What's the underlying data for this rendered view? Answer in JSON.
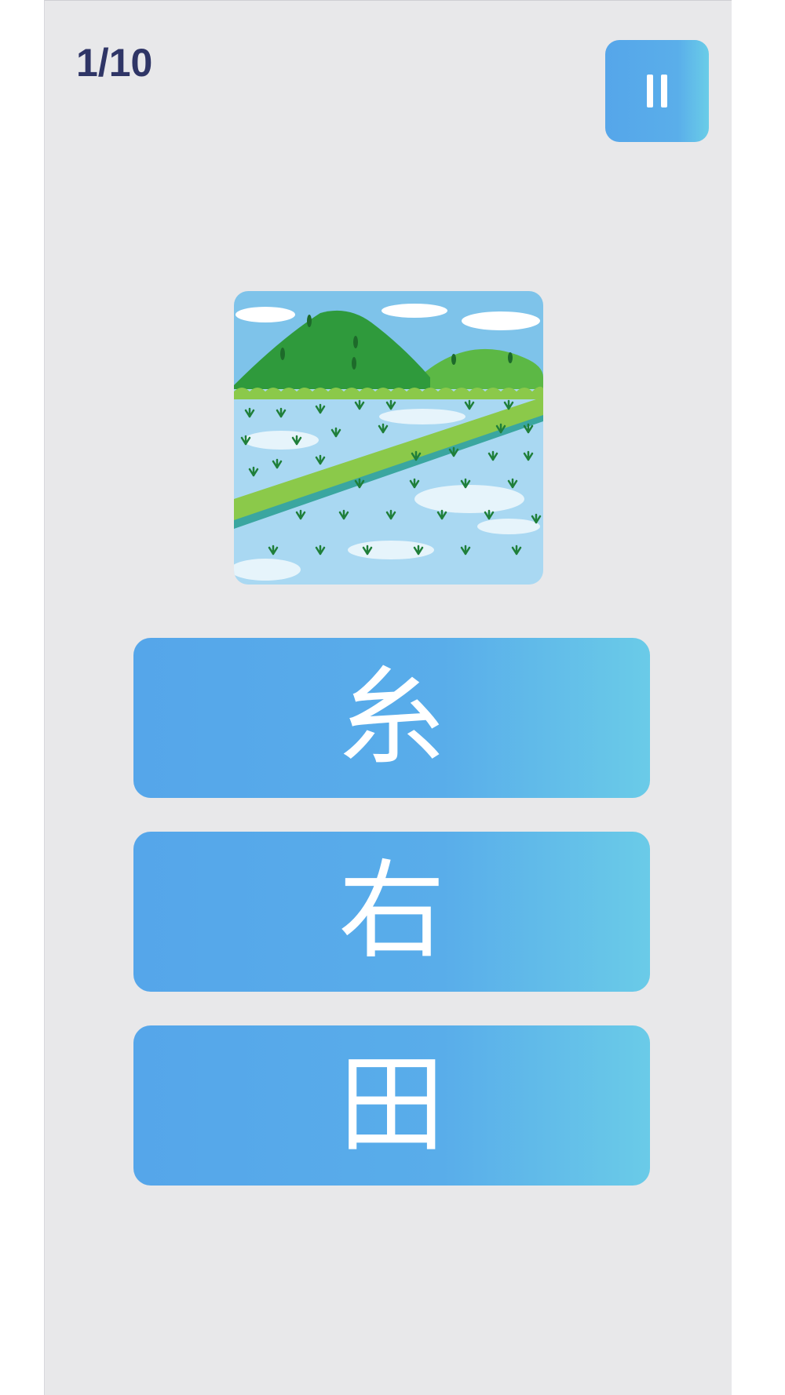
{
  "header": {
    "progress": "1/10",
    "pause_icon": "pause-icon"
  },
  "question": {
    "image_icon": "rice-paddy-field-illustration"
  },
  "answers": [
    {
      "label": "糸"
    },
    {
      "label": "右"
    },
    {
      "label": "田"
    }
  ],
  "colors": {
    "background": "#e8e8ea",
    "button_start": "#55a6ea",
    "button_end": "#6acde8",
    "progress_text": "#2f3566"
  }
}
